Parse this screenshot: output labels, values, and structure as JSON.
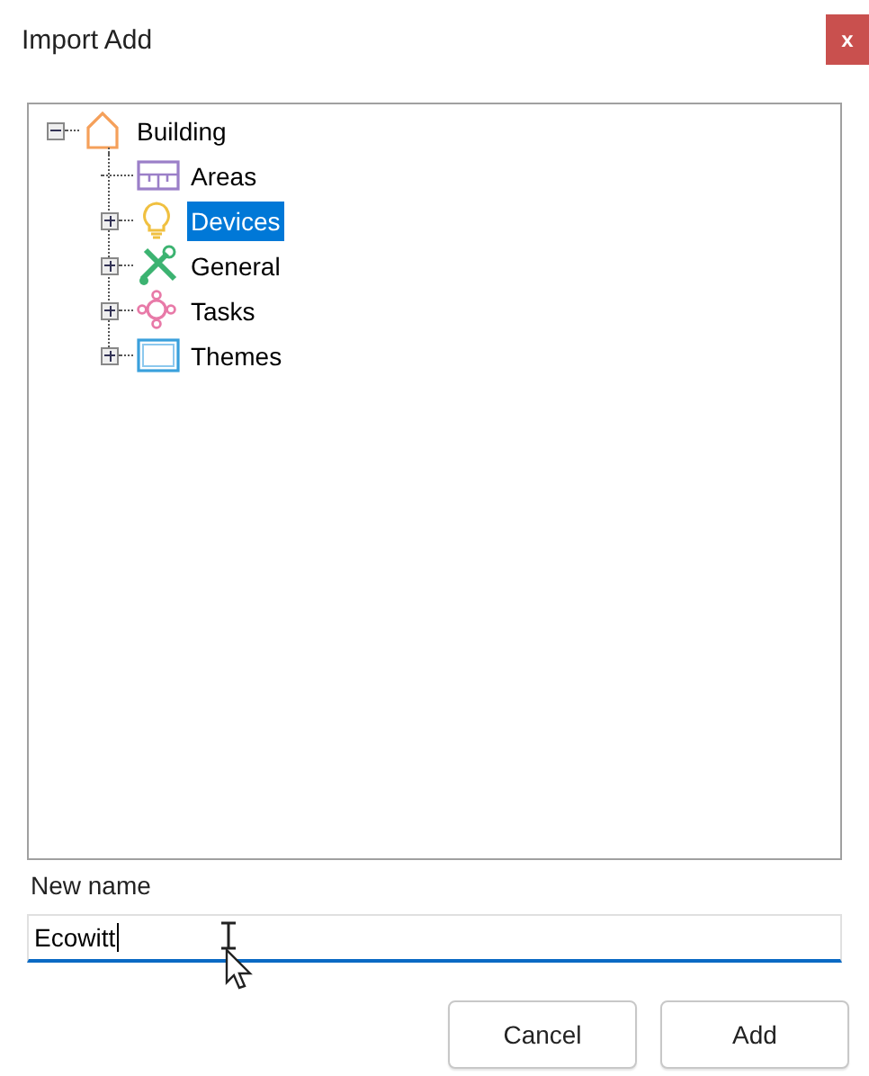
{
  "window": {
    "title": "Import Add",
    "close": "x"
  },
  "tree": [
    {
      "label": "Building",
      "kind": "house",
      "expandable": true,
      "expanded": true,
      "selected": false,
      "children": [
        {
          "label": "Areas",
          "kind": "areas",
          "expandable": false,
          "expanded": false,
          "selected": false
        },
        {
          "label": "Devices",
          "kind": "bulb",
          "expandable": true,
          "expanded": false,
          "selected": true
        },
        {
          "label": "General",
          "kind": "tools",
          "expandable": true,
          "expanded": false,
          "selected": false
        },
        {
          "label": "Tasks",
          "kind": "tasks",
          "expandable": true,
          "expanded": false,
          "selected": false
        },
        {
          "label": "Themes",
          "kind": "themes",
          "expandable": true,
          "expanded": false,
          "selected": false
        }
      ]
    }
  ],
  "name_field": {
    "label": "New name",
    "value": "Ecowitt",
    "focused": true
  },
  "buttons": [
    "Cancel",
    "Add"
  ]
}
